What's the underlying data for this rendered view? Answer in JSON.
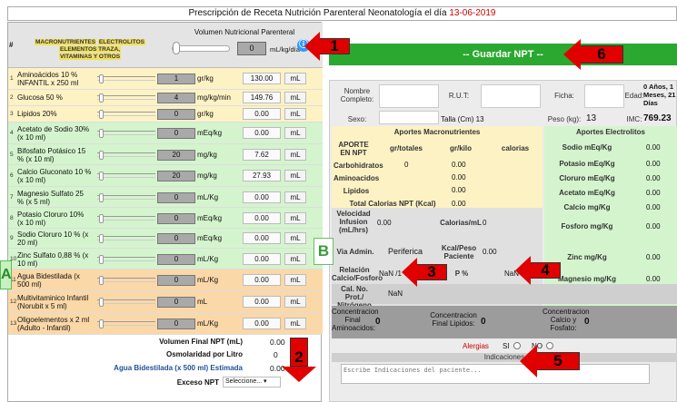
{
  "page": {
    "title_prefix": "Prescripción de Receta Nutrición Parenteral Neonatología el día",
    "title_date": "13-06-2019"
  },
  "header": {
    "hash": "#",
    "tags": [
      "MACRONUTRIENTES",
      "ELECTROLITOS",
      "ELEMENTOS TRAZA,",
      "VITAMINAS Y OTROS"
    ],
    "volume_label": "Volumen Nutricional Parenteral",
    "volume_value": "0",
    "volume_unit": "mL/kg/día",
    "info_icon": "ⓘ"
  },
  "rows": [
    {
      "n": "1",
      "name": "Aminoácidos 10 % INFANTIL x 250 ml",
      "value": "1",
      "unit": "gr/kg",
      "result": "130.00",
      "ml": "mL"
    },
    {
      "n": "2",
      "name": "Glucosa 50 %",
      "value": "4",
      "unit": "mg/kg/min",
      "result": "149.76",
      "ml": "mL"
    },
    {
      "n": "3",
      "name": "Lipidos 20%",
      "value": "0",
      "unit": "gr/kg",
      "result": "0.00",
      "ml": "mL"
    },
    {
      "n": "4",
      "name": "Acetato de Sodio 30% (x 10 ml)",
      "value": "0",
      "unit": "mEq/kg",
      "result": "0.00",
      "ml": "mL"
    },
    {
      "n": "5",
      "name": "Bifosfato Potásico 15 % (x 10 ml)",
      "value": "20",
      "unit": "mg/kg",
      "result": "7.62",
      "ml": "mL"
    },
    {
      "n": "6",
      "name": "Calcio Gluconato 10 % (x 10 ml)",
      "value": "20",
      "unit": "mg/kg",
      "result": "27.93",
      "ml": "mL"
    },
    {
      "n": "7",
      "name": "Magnesio Sulfato 25 % (x 5 ml)",
      "value": "0",
      "unit": "mL/Kg",
      "result": "0.00",
      "ml": "mL"
    },
    {
      "n": "8",
      "name": "Potasio Cloruro 10% (x 10 ml)",
      "value": "0",
      "unit": "mEq/kg",
      "result": "0.00",
      "ml": "mL"
    },
    {
      "n": "9",
      "name": "Sodio Cloruro 10 % (x 20 ml)",
      "value": "0",
      "unit": "mEq/kg",
      "result": "0.00",
      "ml": "mL"
    },
    {
      "n": "10",
      "name": "Zinc Sulfato 0,88 % (x 10 ml)",
      "value": "0",
      "unit": "mL/Kg",
      "result": "0.00",
      "ml": "mL"
    },
    {
      "n": "11",
      "name": "Agua Bidestilada (x 500 ml)",
      "value": "0",
      "unit": "mL/Kg",
      "result": "0.00",
      "ml": "mL"
    },
    {
      "n": "12",
      "name": "Multivitaminico Infantil (Norubit x 5 ml)",
      "value": "0",
      "unit": "mL",
      "result": "0.00",
      "ml": "mL"
    },
    {
      "n": "13",
      "name": "Oligoelementos x 2 ml (Adulto - Infantil)",
      "value": "0",
      "unit": "mL/Kg",
      "result": "0.00",
      "ml": "mL"
    }
  ],
  "summary": {
    "final_label": "Volumen Final NPT (mL)",
    "final_value": "0.00",
    "osm_label": "Osmolaridad por Litro",
    "osm_value": "0",
    "agua_label": "Agua Bidestilada (x 500 ml) Estimada",
    "agua_value": "0.00",
    "exceso_label": "Exceso NPT",
    "exceso_select": "Seleccione... ▾"
  },
  "guardar": "-- Guardar NPT --",
  "form": {
    "nombre": "Nombre Completo:",
    "rut": "R.U.T:",
    "ficha": "Ficha:",
    "edad_label": "Edad:",
    "edad_value": "0 Años, 1 Meses, 21 Días",
    "sexo": "Sexo:",
    "talla": "Talla (Cm) 13",
    "peso_label": "Peso (kg):",
    "peso_value": "13",
    "imc_label": "IMC:",
    "imc_value": "769.23",
    "macro_title": "Aportes Macronutrientes",
    "electro_title": "Aportes Electrolitos",
    "aporte": "APORTE EN NPT",
    "gr_tot": "gr/totales",
    "gr_kilo": "gr/kilo",
    "cal": "calorias",
    "carb": "Carbohidratos",
    "carb_tot": "0",
    "carb_kilo": "0.00",
    "amino": "Aminoacidos",
    "amino_kilo": "0.00",
    "lip": "Lipidos",
    "lip_kilo": "0.00",
    "total_cal": "Total Calorias NPT (Kcal)",
    "total_cal_val": "0.00",
    "elec": [
      {
        "label": "Sodio mEq/Kg",
        "value": "0.00"
      },
      {
        "label": "Potasio mEq/Kg",
        "value": "0.00"
      },
      {
        "label": "Cloruro mEq/Kg",
        "value": "0.00"
      },
      {
        "label": "Acetato mEq/Kg",
        "value": "0.00"
      },
      {
        "label": "Calcio mg/Kg",
        "value": "0.00"
      },
      {
        "label": "Fosforo mg/Kg",
        "value": "0.00"
      },
      {
        "label": "Zinc mg/Kg",
        "value": "0.00"
      },
      {
        "label": "Magnesio mg/Kg",
        "value": "0.00"
      }
    ],
    "vel_label": "Velocidad Infusion (mL/hrs)",
    "vel_val": "0.00",
    "calml_label": "Calorias/mL",
    "calml_val": "0",
    "via_label": "Via Admin.",
    "via_val": "Periferica",
    "kcal_label": "Kcal/Peso Paciente",
    "kcal_val": "0.00",
    "rel_label": "Relación Calcio/Fosforo",
    "rel_val": "NaN /1",
    "p_label": "P %",
    "p_val": "NaN",
    "cal_prot_label": "Cal. No. Prot./ Nitrógeno",
    "cal_prot_val": "NaN",
    "conc_amino_label": "Concentracion Final Aminoacidos:",
    "conc_amino_val": "0",
    "conc_lip_label": "Concentracion Final Lipidos:",
    "conc_lip_val": "0",
    "conc_cal_label": "Concentracion Calcio y Fosfato:",
    "conc_cal_val": "0",
    "alergias": "Alergias",
    "si": "SI",
    "no": "NO",
    "indicaciones": "Indicaciones",
    "indic_placeholder": "Escribe Indicaciones del paciente..."
  },
  "annotations": {
    "a1": "1",
    "a2": "2",
    "a3": "3",
    "a4": "4",
    "a5": "5",
    "a6": "6",
    "A": "A",
    "B": "B"
  },
  "colors": {
    "yellow": "#fdf2c4",
    "green": "#d4f4cd",
    "orange": "#fbd8a8",
    "gray": "#e4e4e4",
    "arrow": "#e00000",
    "guardar": "#2aa830"
  }
}
